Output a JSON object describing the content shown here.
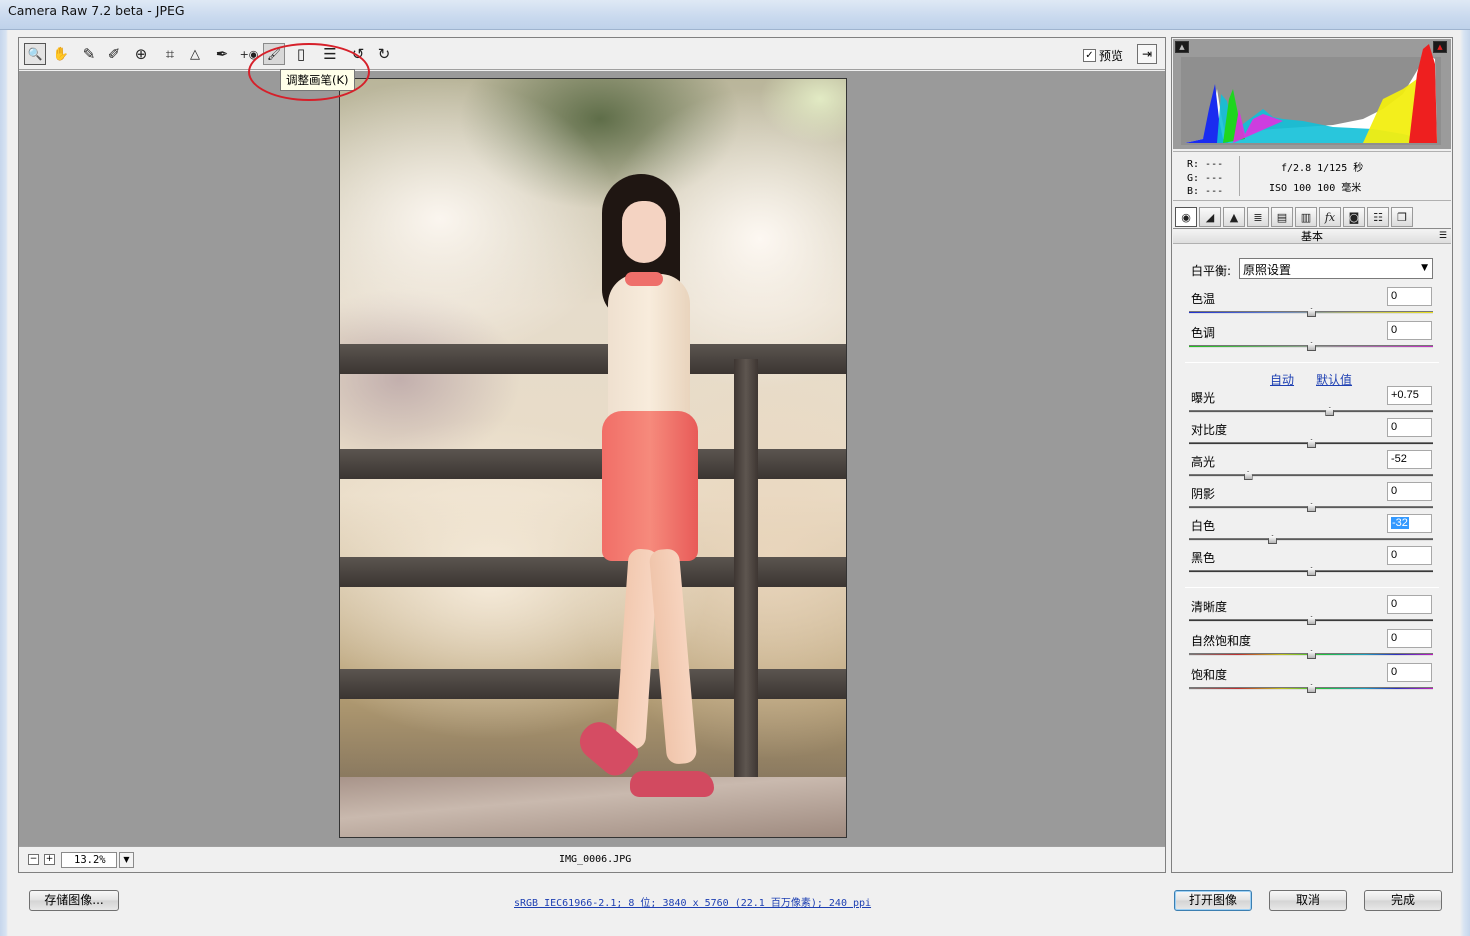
{
  "window": {
    "title": "Camera Raw 7.2 beta -  JPEG"
  },
  "toolbar": {
    "tools": [
      {
        "name": "zoom-tool",
        "icon": "magnifier-icon",
        "glyph": "🔍"
      },
      {
        "name": "hand-tool",
        "icon": "hand-icon",
        "glyph": "✋"
      },
      {
        "name": "white-balance-tool",
        "icon": "eyedropper-icon",
        "glyph": "✎"
      },
      {
        "name": "color-sampler-tool",
        "icon": "color-sampler-icon",
        "glyph": "✐"
      },
      {
        "name": "targeted-adjustment-tool",
        "icon": "target-adjust-icon",
        "glyph": "⊕"
      },
      {
        "name": "crop-tool",
        "icon": "crop-icon",
        "glyph": "⌗"
      },
      {
        "name": "straighten-tool",
        "icon": "straighten-icon",
        "glyph": "△"
      },
      {
        "name": "spot-removal-tool",
        "icon": "spot-removal-icon",
        "glyph": "✒"
      },
      {
        "name": "red-eye-tool",
        "icon": "red-eye-icon",
        "glyph": "+◉"
      },
      {
        "name": "adjustment-brush-tool",
        "icon": "brush-icon",
        "glyph": "🖌"
      },
      {
        "name": "graduated-filter-tool",
        "icon": "graduated-filter-icon",
        "glyph": "▯"
      },
      {
        "name": "preferences-tool",
        "icon": "list-icon",
        "glyph": "☰"
      },
      {
        "name": "rotate-left-tool",
        "icon": "rotate-ccw-icon",
        "glyph": "↺"
      },
      {
        "name": "rotate-right-tool",
        "icon": "rotate-cw-icon",
        "glyph": "↻"
      }
    ],
    "tooltip": "调整画笔(K)",
    "preview_label": "预览",
    "preview_checked": "✓"
  },
  "status": {
    "zoom": "13.2%",
    "filename": "IMG_0006.JPG"
  },
  "histogram": {
    "readout": {
      "r": "R:  ---",
      "g": "G:  ---",
      "b": "B:  ---"
    },
    "exif_line1": "f/2.8   1/125 秒",
    "exif_line2": "ISO 100   100 毫米"
  },
  "panel": {
    "title": "基本",
    "tabs": [
      {
        "name": "basic-tab",
        "icon": "aperture-icon",
        "glyph": "◉"
      },
      {
        "name": "tone-curve-tab",
        "icon": "tone-curve-icon",
        "glyph": "◢"
      },
      {
        "name": "detail-tab",
        "icon": "detail-icon",
        "glyph": "▲"
      },
      {
        "name": "hsl-tab",
        "icon": "hsl-icon",
        "glyph": "≣"
      },
      {
        "name": "split-toning-tab",
        "icon": "split-toning-icon",
        "glyph": "▤"
      },
      {
        "name": "lens-corrections-tab",
        "icon": "lens-icon",
        "glyph": "▥"
      },
      {
        "name": "effects-tab",
        "icon": "fx-icon",
        "glyph": "fx"
      },
      {
        "name": "camera-calibration-tab",
        "icon": "camera-icon",
        "glyph": "◙"
      },
      {
        "name": "presets-tab",
        "icon": "presets-icon",
        "glyph": "☷"
      },
      {
        "name": "snapshots-tab",
        "icon": "snapshots-icon",
        "glyph": "❐"
      }
    ],
    "white_balance_label": "白平衡:",
    "white_balance_value": "原照设置",
    "auto_label": "自动",
    "default_label": "默认值",
    "sliders": [
      {
        "key": "temp",
        "label": "色温",
        "value": "0",
        "pos": 0.5,
        "track": "temp"
      },
      {
        "key": "tint",
        "label": "色调",
        "value": "0",
        "pos": 0.5,
        "track": "tint"
      },
      {
        "key": "exposure",
        "label": "曝光",
        "value": "+0.75",
        "pos": 0.575,
        "track": "gray"
      },
      {
        "key": "contrast",
        "label": "对比度",
        "value": "0",
        "pos": 0.5,
        "track": "dark"
      },
      {
        "key": "highlights",
        "label": "高光",
        "value": "-52",
        "pos": 0.24,
        "track": "gray"
      },
      {
        "key": "shadows",
        "label": "阴影",
        "value": "0",
        "pos": 0.5,
        "track": "gray"
      },
      {
        "key": "whites",
        "label": "白色",
        "value": "-32",
        "pos": 0.34,
        "track": "gray",
        "selected": true
      },
      {
        "key": "blacks",
        "label": "黑色",
        "value": "0",
        "pos": 0.5,
        "track": "dark"
      },
      {
        "key": "clarity",
        "label": "清晰度",
        "value": "0",
        "pos": 0.5,
        "track": "dark"
      },
      {
        "key": "vibrance",
        "label": "自然饱和度",
        "value": "0",
        "pos": 0.5,
        "track": "rainbow"
      },
      {
        "key": "saturation",
        "label": "饱和度",
        "value": "0",
        "pos": 0.5,
        "track": "rainbow"
      }
    ]
  },
  "footer": {
    "save_label": "存储图像...",
    "workflow_text": "sRGB IEC61966-2.1; 8 位; 3840 x 5760 (22.1 百万像素); 240 ppi",
    "open_label": "打开图像",
    "cancel_label": "取消",
    "done_label": "完成"
  }
}
